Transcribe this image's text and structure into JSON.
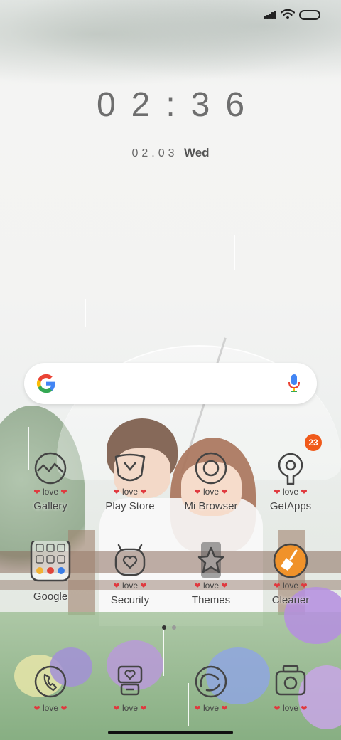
{
  "status_bar": {
    "signal": "signal-icon",
    "wifi": "wifi-icon",
    "battery": "battery-icon"
  },
  "clock": {
    "time": "02:36",
    "date": "02.03",
    "day": "Wed"
  },
  "search": {
    "logo": "google-g-icon",
    "mic": "mic-icon"
  },
  "love_text": "love",
  "apps": [
    {
      "label": "Gallery",
      "icon": "gallery-icon"
    },
    {
      "label": "Play Store",
      "icon": "play-store-icon"
    },
    {
      "label": "Mi Browser",
      "icon": "browser-icon"
    },
    {
      "label": "GetApps",
      "icon": "getapps-icon",
      "badge": "23"
    },
    {
      "label": "Google",
      "icon": "google-folder-icon"
    },
    {
      "label": "Security",
      "icon": "security-icon"
    },
    {
      "label": "Themes",
      "icon": "themes-icon"
    },
    {
      "label": "Cleaner",
      "icon": "cleaner-icon"
    }
  ],
  "dock": [
    {
      "icon": "phone-icon"
    },
    {
      "icon": "messages-icon"
    },
    {
      "icon": "camera-shutter-icon"
    },
    {
      "icon": "camera-icon"
    }
  ],
  "colors": {
    "heart": "#e0393e",
    "badge": "#f05a1a",
    "cleaner": "#f0922a"
  },
  "page_indicator": {
    "pages": 2,
    "current": 1
  }
}
